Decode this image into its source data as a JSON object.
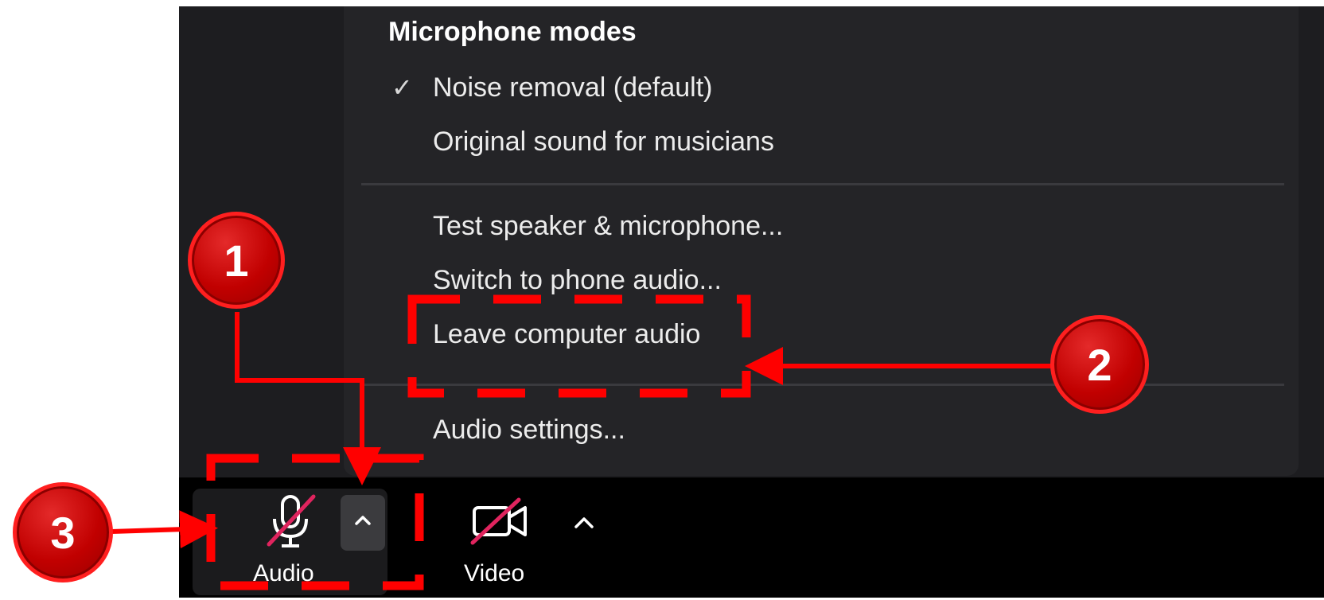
{
  "menu": {
    "header": "Microphone modes",
    "check_glyph": "✓",
    "items": [
      {
        "label": "Noise removal (default)",
        "checked": true
      },
      {
        "label": "Original sound for musicians",
        "checked": false
      },
      {
        "label": "Test speaker & microphone...",
        "checked": false
      },
      {
        "label": "Switch to phone audio...",
        "checked": false
      },
      {
        "label": "Leave computer audio",
        "checked": false
      },
      {
        "label": "Audio settings...",
        "checked": false
      }
    ]
  },
  "toolbar": {
    "audio_label": "Audio",
    "video_label": "Video",
    "audio_icon": "microphone-muted-icon",
    "video_icon": "video-camera-off-icon",
    "caret_icon": "chevron-up-icon"
  },
  "annotations": {
    "badge_1": "1",
    "badge_2": "2",
    "badge_3": "3",
    "color": "#ff0000"
  },
  "colors": {
    "menu_bg": "#242427",
    "toolbar_bg": "#000000",
    "mute_slash": "#e0245e"
  }
}
